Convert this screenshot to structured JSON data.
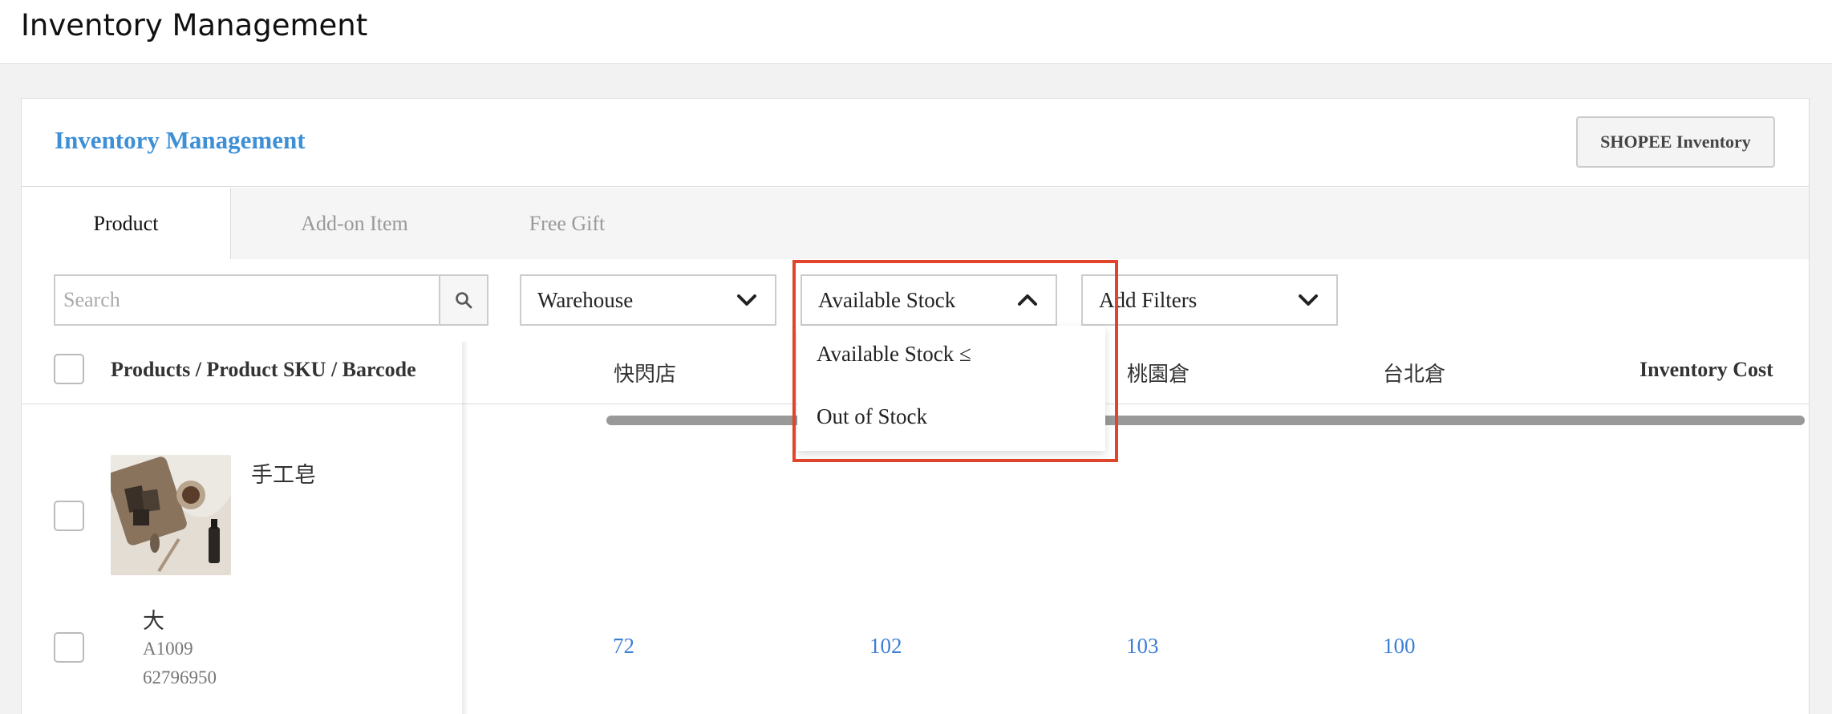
{
  "topbar": {
    "title": "Inventory Management"
  },
  "card": {
    "title": "Inventory Management",
    "shopee_button": "SHOPEE Inventory"
  },
  "tabs": [
    {
      "label": "Product",
      "active": true
    },
    {
      "label": "Add-on Item",
      "active": false
    },
    {
      "label": "Free Gift",
      "active": false
    }
  ],
  "search": {
    "placeholder": "Search",
    "icon": "search-icon"
  },
  "filters": {
    "warehouse": "Warehouse",
    "available_stock": "Available Stock",
    "add_filters": "Add Filters"
  },
  "dropdown": {
    "items": [
      "Available Stock ≤",
      "Out of Stock"
    ]
  },
  "table": {
    "columns": {
      "product": "Products / Product SKU / Barcode",
      "flash_store": "快閃店",
      "taoyuan": "桃園倉",
      "taipei": "台北倉",
      "inventory_cost": "Inventory Cost"
    },
    "product": {
      "name": "手工皂",
      "variant": {
        "name": "大",
        "sku": "A1009",
        "barcode": "62796950",
        "stock": [
          "72",
          "102",
          "103",
          "100"
        ]
      }
    }
  },
  "colors": {
    "accent": "#3d8fd6",
    "highlight": "#e0452b",
    "link": "#3d7fd6"
  }
}
